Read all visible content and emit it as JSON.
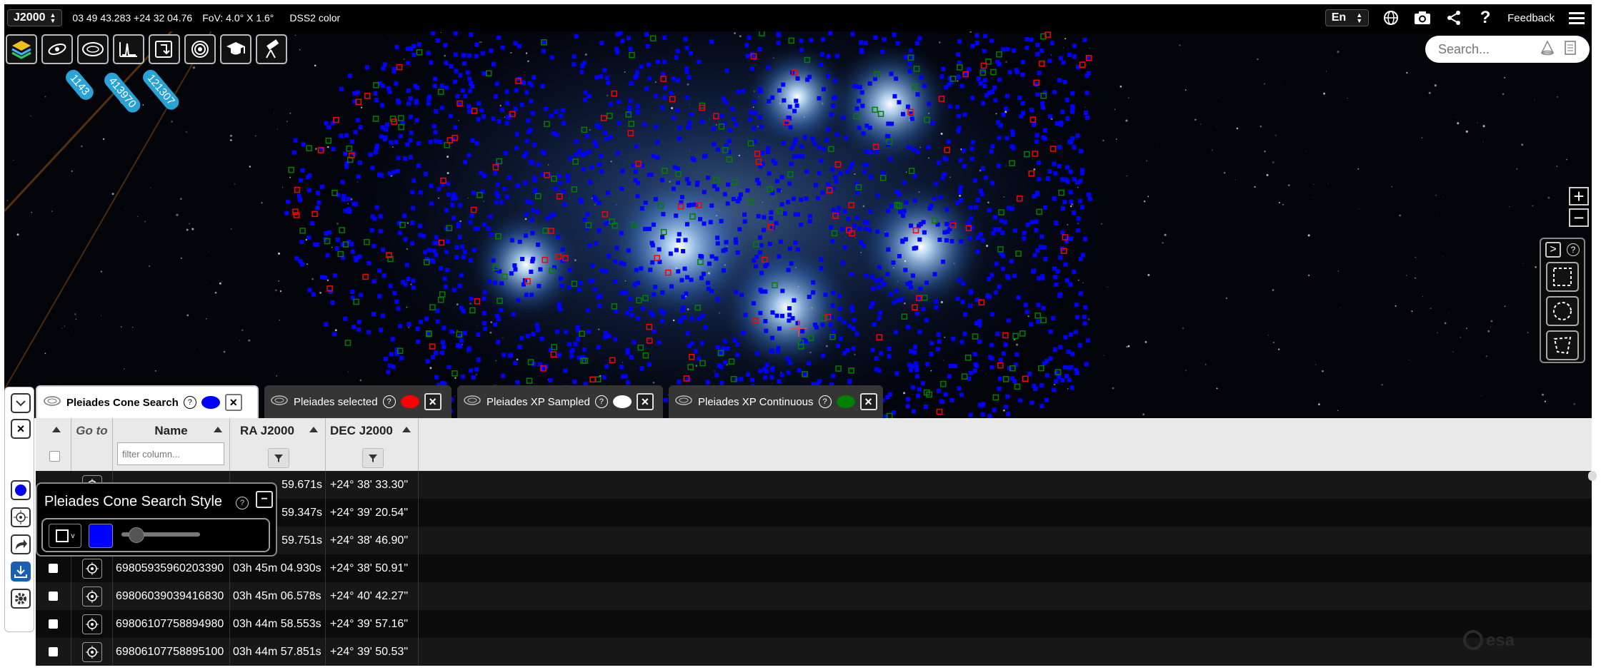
{
  "colors": {
    "accent": "#29a3d6",
    "cone_search": "#0000ff",
    "selected": "#ff0000",
    "xp_sampled": "#ffffff",
    "xp_continuous": "#008000"
  },
  "topbar": {
    "coord_system": "J2000",
    "center_coords": "03 49 43.283 +24 32 04.76",
    "fov": "FoV: 4.0° X 1.6°",
    "survey": "DSS2 color",
    "language": "En",
    "feedback": "Feedback"
  },
  "tools": [
    "layers-icon",
    "galaxy-icon",
    "catalog-icon",
    "spectra-icon",
    "outreach-icon",
    "target-icon",
    "education-icon",
    "telescope-icon"
  ],
  "badges": [
    "1143",
    "413970",
    "121307"
  ],
  "search": {
    "placeholder": "Search..."
  },
  "tabs": [
    {
      "label": "Pleiades Cone Search",
      "color": "#0000ff",
      "active": true
    },
    {
      "label": "Pleiades selected",
      "color": "#ff0000",
      "active": false
    },
    {
      "label": "Pleiades XP Sampled",
      "color": "#ffffff",
      "active": false
    },
    {
      "label": "Pleiades XP Continuous",
      "color": "#008000",
      "active": false
    }
  ],
  "table": {
    "columns": {
      "goto": "Go to",
      "name": "Name",
      "ra": "RA J2000",
      "dec": "DEC J2000"
    },
    "filter_placeholder": "filter column...",
    "rows": [
      {
        "name": "69805935960203390",
        "ra": "03h 45m 04.930s",
        "dec": "+24° 38' 50.91\""
      },
      {
        "name": "69806039039416830",
        "ra": "03h 45m 06.578s",
        "dec": "+24° 40' 42.27\""
      },
      {
        "name": "69806107758894980",
        "ra": "03h 44m 58.553s",
        "dec": "+24° 39' 57.16\""
      },
      {
        "name": "69806107758895100",
        "ra": "03h 44m 57.851s",
        "dec": "+24° 39' 50.53\""
      }
    ],
    "partial_rows": [
      {
        "ra": "59.671s",
        "dec": "+24° 38' 33.30\""
      },
      {
        "ra": "59.347s",
        "dec": "+24° 39' 20.54\""
      },
      {
        "ra": "59.751s",
        "dec": "+24° 38' 46.90\""
      }
    ]
  },
  "style_popup": {
    "title": "Pleiades Cone Search Style",
    "color": "#0000ff"
  }
}
